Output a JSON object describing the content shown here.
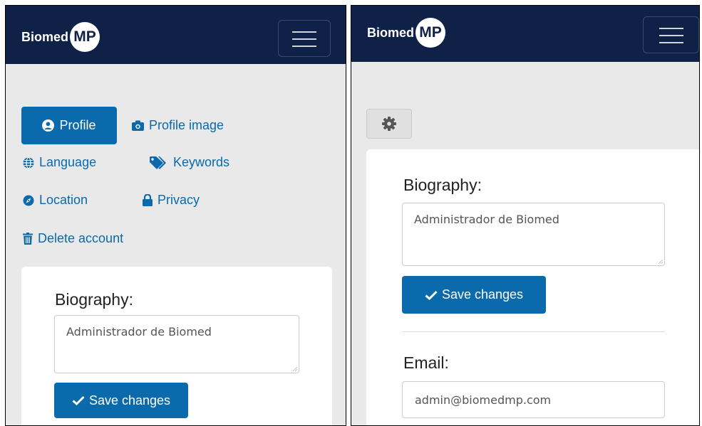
{
  "brand": {
    "text": "Biomed",
    "badge": "MP"
  },
  "left": {
    "tabs": {
      "profile": "Profile",
      "profile_image": "Profile image",
      "language": "Language",
      "keywords": "Keywords",
      "location": "Location",
      "privacy": "Privacy",
      "delete_account": "Delete account"
    },
    "biography": {
      "label": "Biography:",
      "value": "Administrador de Biomed",
      "save": "Save changes"
    }
  },
  "right": {
    "biography": {
      "label": "Biography:",
      "value": "Administrador de Biomed",
      "save": "Save changes"
    },
    "email": {
      "label": "Email:",
      "value": "admin@biomedmp.com"
    }
  },
  "icons": [
    "user-circle-icon",
    "camera-icon",
    "globe-icon",
    "tags-icon",
    "compass-icon",
    "lock-icon",
    "trash-icon",
    "check-icon",
    "gear-icon",
    "hamburger-icon"
  ],
  "colors": {
    "navbar": "#0f2147",
    "primary": "#0a6aab",
    "background": "#e9e9e9"
  }
}
